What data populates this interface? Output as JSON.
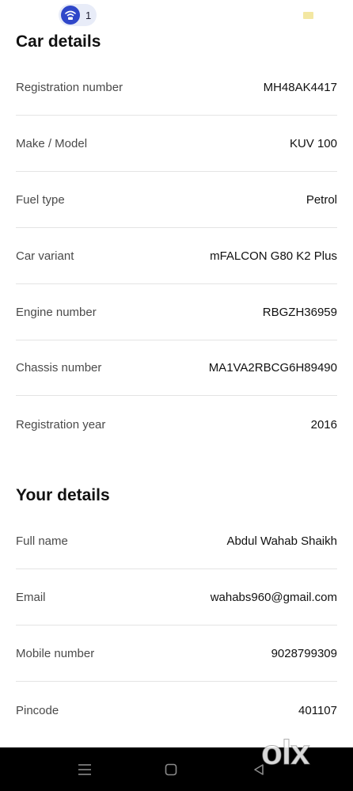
{
  "status_bar": {
    "notification_count": "1"
  },
  "car_details": {
    "title": "Car details",
    "rows": [
      {
        "label": "Registration number",
        "value": "MH48AK4417"
      },
      {
        "label": "Make / Model",
        "value": "KUV 100"
      },
      {
        "label": "Fuel type",
        "value": "Petrol"
      },
      {
        "label": "Car variant",
        "value": "mFALCON G80 K2 Plus"
      },
      {
        "label": "Engine number",
        "value": "RBGZH36959"
      },
      {
        "label": "Chassis number",
        "value": "MA1VA2RBCG6H89490"
      },
      {
        "label": "Registration year",
        "value": "2016"
      }
    ]
  },
  "your_details": {
    "title": "Your details",
    "rows": [
      {
        "label": "Full name",
        "value": "Abdul Wahab Shaikh"
      },
      {
        "label": "Email",
        "value": "wahabs960@gmail.com"
      },
      {
        "label": "Mobile number",
        "value": "9028799309"
      },
      {
        "label": "Pincode",
        "value": "401107"
      }
    ]
  },
  "watermark": "olx",
  "icons": {
    "notification": "wifi-hotspot-icon",
    "battery": "battery-icon",
    "nav_menu": "menu-icon",
    "nav_home": "home-icon",
    "nav_back": "back-icon"
  },
  "colors": {
    "notification_accent": "#2f47c9",
    "divider": "#e4e4e4",
    "nav_background": "#000000"
  }
}
